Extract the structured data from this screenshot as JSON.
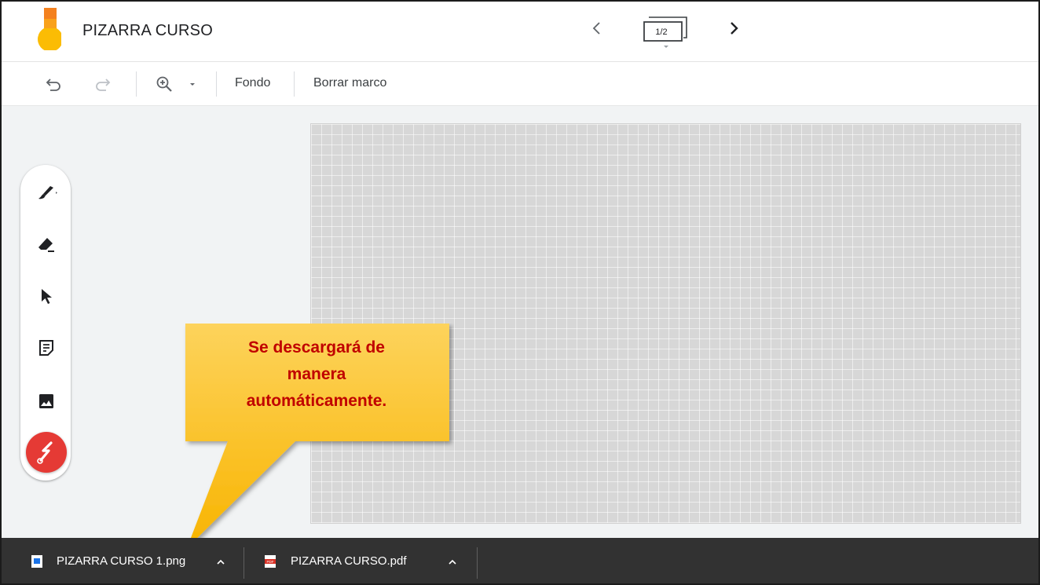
{
  "header": {
    "title": "PIZARRA CURSO",
    "page_indicator": "1/2",
    "prev_icon": "chevron-left-icon",
    "next_icon": "chevron-right-icon"
  },
  "toolbar": {
    "undo_icon": "undo-icon",
    "redo_icon": "redo-icon",
    "zoom_icon": "zoom-in-icon",
    "background_label": "Fondo",
    "clear_frame_label": "Borrar marco"
  },
  "tools": [
    {
      "name": "pen",
      "icon": "pen-icon"
    },
    {
      "name": "eraser",
      "icon": "eraser-icon"
    },
    {
      "name": "select",
      "icon": "cursor-arrow-icon"
    },
    {
      "name": "sticky-note",
      "icon": "sticky-note-icon"
    },
    {
      "name": "image",
      "icon": "image-icon"
    },
    {
      "name": "laser",
      "icon": "laser-pointer-icon"
    }
  ],
  "callout": {
    "line1": "Se descargará de",
    "line2": "manera",
    "line3": "automáticamente."
  },
  "downloads": [
    {
      "filename": "PIZARRA CURSO 1.png",
      "icon": "png-file-icon"
    },
    {
      "filename": "PIZARRA CURSO.pdf",
      "icon": "pdf-file-icon"
    }
  ],
  "colors": {
    "accent_red": "#e53a35",
    "callout_fill": "#fcc419",
    "callout_text": "#c00000",
    "download_bar": "#323232"
  }
}
